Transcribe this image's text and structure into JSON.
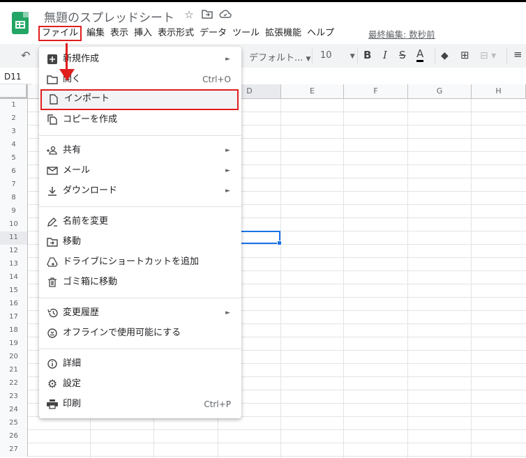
{
  "header": {
    "title": "無題のスプレッドシート",
    "icons": [
      "star-icon",
      "move-to-folder-icon",
      "cloud-status-icon"
    ],
    "last_edit": "最終編集: 数秒前"
  },
  "menubar": [
    "ファイル",
    "編集",
    "表示",
    "挿入",
    "表示形式",
    "データ",
    "ツール",
    "拡張機能",
    "ヘルプ"
  ],
  "toolbar": {
    "font": "デフォルト...",
    "font_size": "10",
    "bold": "B",
    "italic": "I",
    "strike": "S",
    "text_color": "A"
  },
  "cell_ref": "D11",
  "columns": [
    "D",
    "E",
    "F",
    "G",
    "H"
  ],
  "rows": [
    "1",
    "2",
    "3",
    "4",
    "5",
    "6",
    "7",
    "8",
    "9",
    "10",
    "11",
    "12",
    "13",
    "14",
    "15",
    "16",
    "17",
    "18",
    "19",
    "20",
    "21",
    "22",
    "23",
    "24",
    "25",
    "26",
    "27"
  ],
  "file_menu": {
    "new": "新規作成",
    "open": "開く",
    "open_shortcut": "Ctrl+O",
    "import": "インポート",
    "copy": "コピーを作成",
    "share": "共有",
    "email": "メール",
    "download": "ダウンロード",
    "rename": "名前を変更",
    "move": "移動",
    "shortcut": "ドライブにショートカットを追加",
    "trash": "ゴミ箱に移動",
    "history": "変更履歴",
    "offline": "オフラインで使用可能にする",
    "details": "詳細",
    "settings": "設定",
    "print": "印刷",
    "print_shortcut": "Ctrl+P"
  },
  "colors": {
    "accent": "#e01e1e",
    "brand": "#23a566",
    "selection": "#1a73e8"
  }
}
